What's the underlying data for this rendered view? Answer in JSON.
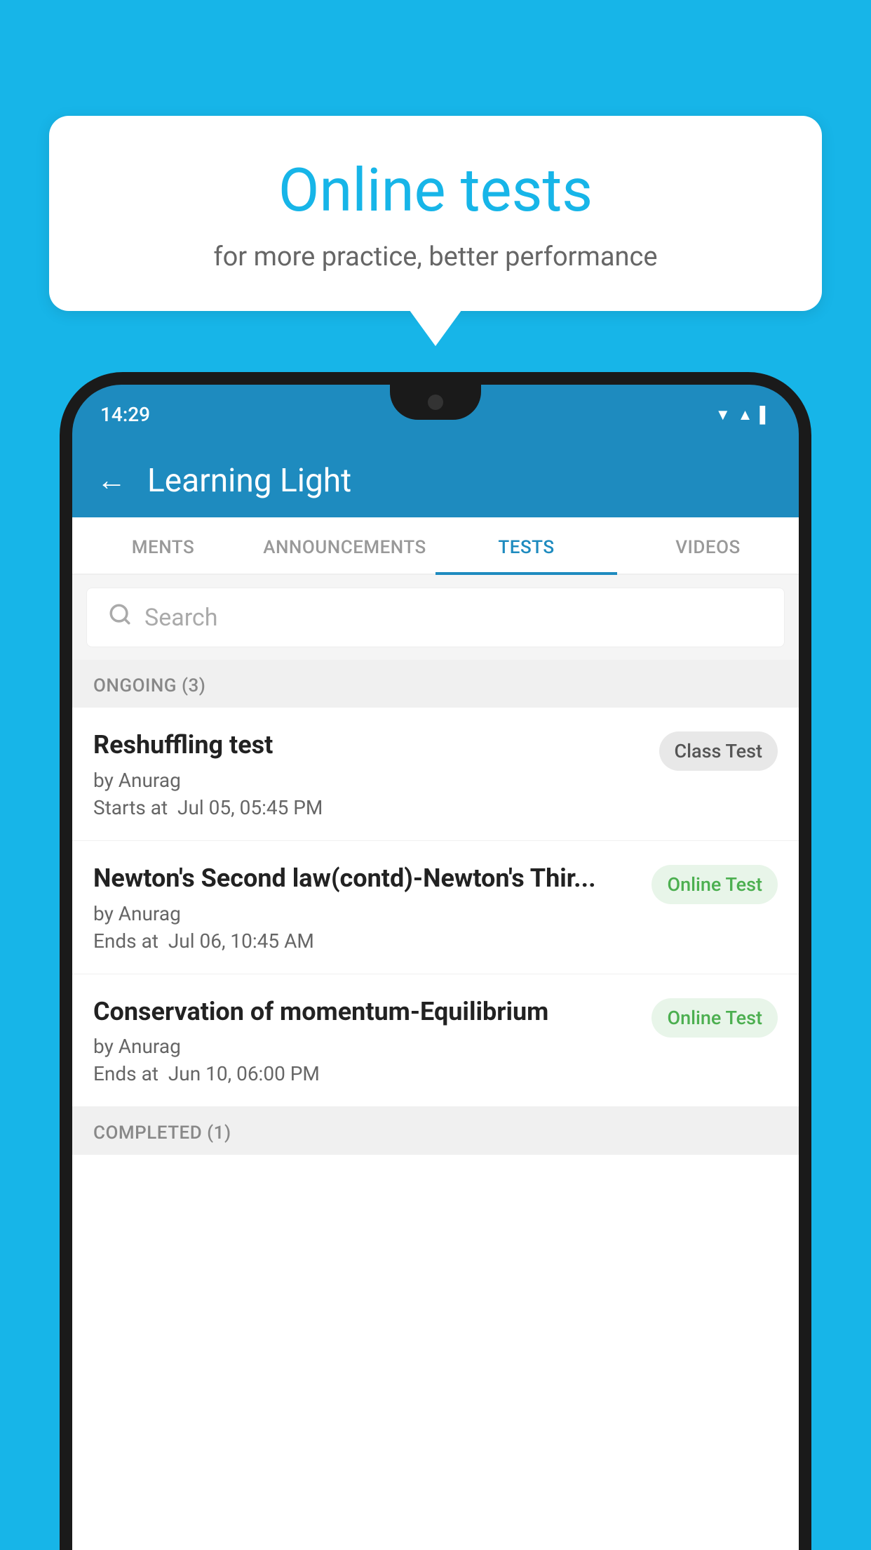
{
  "background_color": "#17b5e8",
  "bubble": {
    "title": "Online tests",
    "subtitle": "for more practice, better performance"
  },
  "phone": {
    "status_time": "14:29",
    "app_name": "Learning Light",
    "tabs": [
      {
        "label": "MENTS",
        "active": false
      },
      {
        "label": "ANNOUNCEMENTS",
        "active": false
      },
      {
        "label": "TESTS",
        "active": true
      },
      {
        "label": "VIDEOS",
        "active": false
      }
    ],
    "search_placeholder": "Search",
    "section_ongoing": "ONGOING (3)",
    "section_completed": "COMPLETED (1)",
    "tests": [
      {
        "name": "Reshuffling test",
        "author": "by Anurag",
        "time_label": "Starts at",
        "time_value": "Jul 05, 05:45 PM",
        "badge": "Class Test",
        "badge_type": "class"
      },
      {
        "name": "Newton's Second law(contd)-Newton's Thir...",
        "author": "by Anurag",
        "time_label": "Ends at",
        "time_value": "Jul 06, 10:45 AM",
        "badge": "Online Test",
        "badge_type": "online"
      },
      {
        "name": "Conservation of momentum-Equilibrium",
        "author": "by Anurag",
        "time_label": "Ends at",
        "time_value": "Jun 10, 06:00 PM",
        "badge": "Online Test",
        "badge_type": "online"
      }
    ]
  }
}
